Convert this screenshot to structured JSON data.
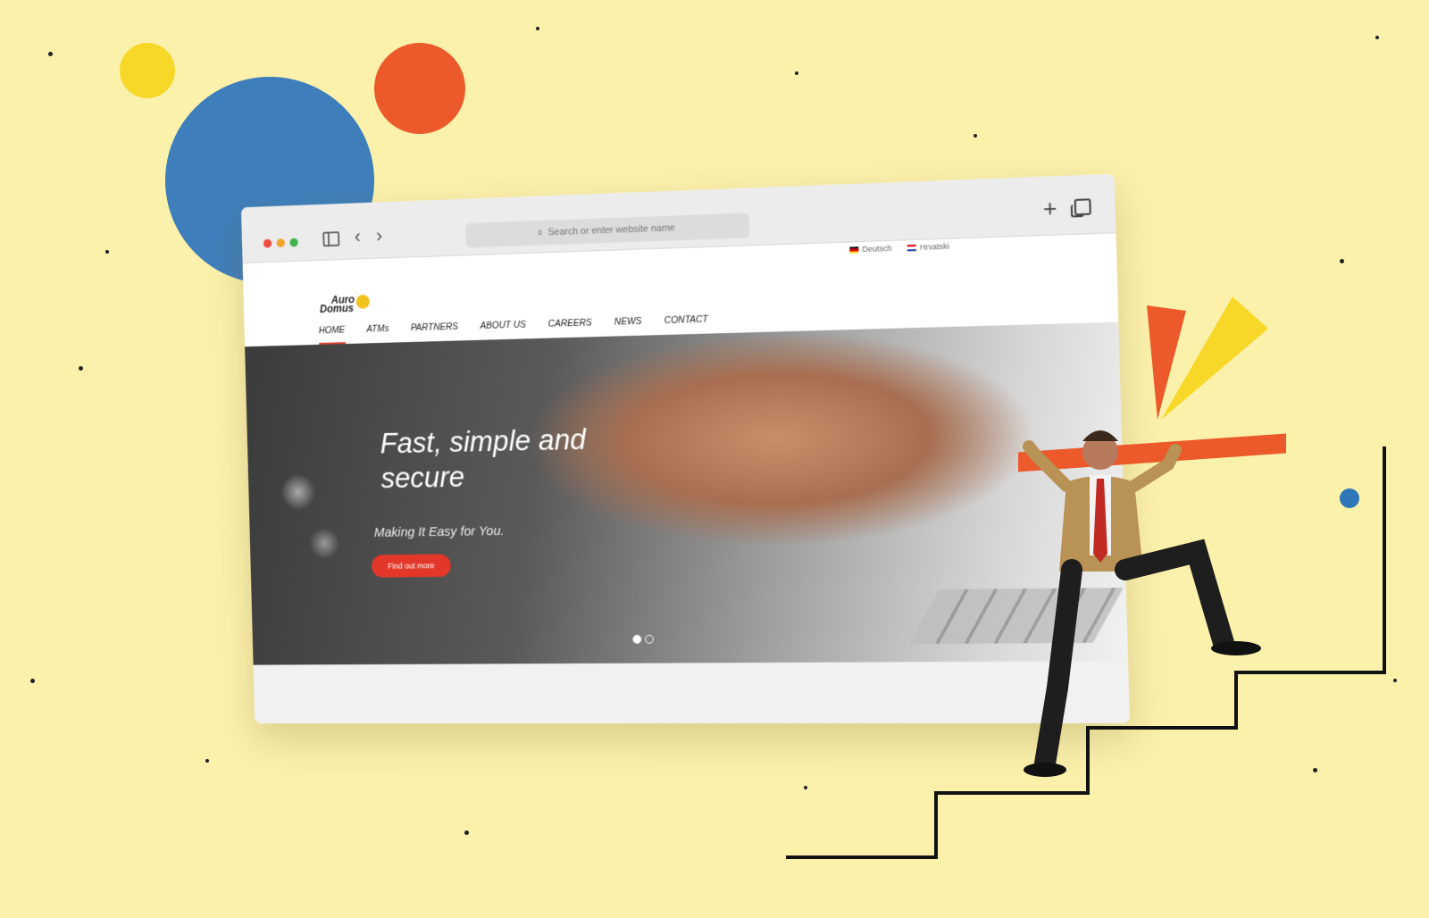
{
  "browser": {
    "url_placeholder": "Search or enter website name",
    "languages": [
      {
        "label": "Deutsch",
        "flag": "de-flag-icon"
      },
      {
        "label": "Hrvatski",
        "flag": "hr-flag-icon"
      }
    ]
  },
  "site": {
    "logo_line1": "Auro",
    "logo_line2": "Domus",
    "nav": [
      "HOME",
      "ATMs",
      "PARTNERS",
      "ABOUT US",
      "CAREERS",
      "NEWS",
      "CONTACT"
    ],
    "active_nav": "HOME",
    "hero": {
      "title": "Fast, simple and secure",
      "subtitle": "Making It Easy for You.",
      "cta": "Find out more",
      "slides": 2,
      "active_slide": 1
    }
  },
  "colors": {
    "background": "#fbf1ab",
    "accent": "#e3372a",
    "blue": "#3e7ebb",
    "orange": "#ec5a2c",
    "yellow": "#f7d829"
  }
}
